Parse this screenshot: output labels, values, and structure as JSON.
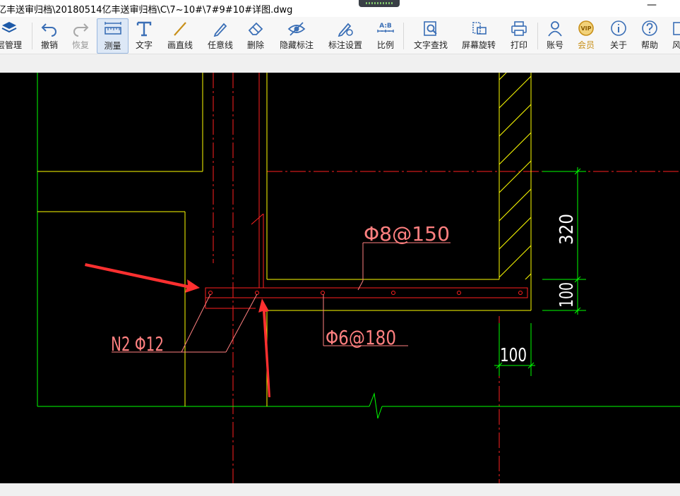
{
  "window": {
    "title": "亿丰送审归档\\20180514亿丰送审归档\\C\\7~10#\\7#9#10#详图.dwg",
    "minimize_glyph": "—"
  },
  "toolbar": {
    "items": [
      {
        "id": "layers",
        "label": "层管理",
        "icon": "layers-icon"
      },
      {
        "id": "undo",
        "label": "撤销",
        "icon": "undo-icon"
      },
      {
        "id": "redo",
        "label": "恢复",
        "icon": "redo-icon",
        "disabled": true
      },
      {
        "id": "measure",
        "label": "测量",
        "icon": "ruler-icon",
        "active": true
      },
      {
        "id": "text",
        "label": "文字",
        "icon": "text-icon"
      },
      {
        "id": "line",
        "label": "画直线",
        "icon": "line-icon"
      },
      {
        "id": "freeline",
        "label": "任意线",
        "icon": "pen-icon"
      },
      {
        "id": "delete",
        "label": "删除",
        "icon": "eraser-icon"
      },
      {
        "id": "hide",
        "label": "隐藏标注",
        "icon": "eye-off-icon"
      },
      {
        "id": "annoset",
        "label": "标注设置",
        "icon": "annotation-settings-icon"
      },
      {
        "id": "scale",
        "label": "比例",
        "icon": "scale-icon"
      },
      {
        "id": "find",
        "label": "文字查找",
        "icon": "text-search-icon"
      },
      {
        "id": "rotate",
        "label": "屏幕旋转",
        "icon": "rotate-screen-icon"
      },
      {
        "id": "print",
        "label": "打印",
        "icon": "printer-icon"
      },
      {
        "id": "account",
        "label": "账号",
        "icon": "user-icon"
      },
      {
        "id": "vip",
        "label": "会员",
        "icon": "vip-icon"
      },
      {
        "id": "about",
        "label": "关于",
        "icon": "info-icon"
      },
      {
        "id": "help",
        "label": "帮助",
        "icon": "help-icon"
      },
      {
        "id": "more",
        "label": "风",
        "icon": "style-icon"
      }
    ],
    "scale_icon_text": "A:B",
    "vip_icon_text": "VIP"
  },
  "drawing": {
    "labels": {
      "top_rebar": "Φ8@150",
      "bottom_rebar": "Φ6@180",
      "main_rebar": "N2 Φ12",
      "dim_320": "320",
      "dim_100_vertical": "100",
      "dim_100_horizontal": "100"
    },
    "colors": {
      "background": "#000000",
      "wall": "#ffff00",
      "rebar": "#ff2020",
      "text": "#ff8080",
      "dimension": "#00ff00",
      "dim_text": "#ffffff",
      "arrow": "#ff3030"
    }
  }
}
